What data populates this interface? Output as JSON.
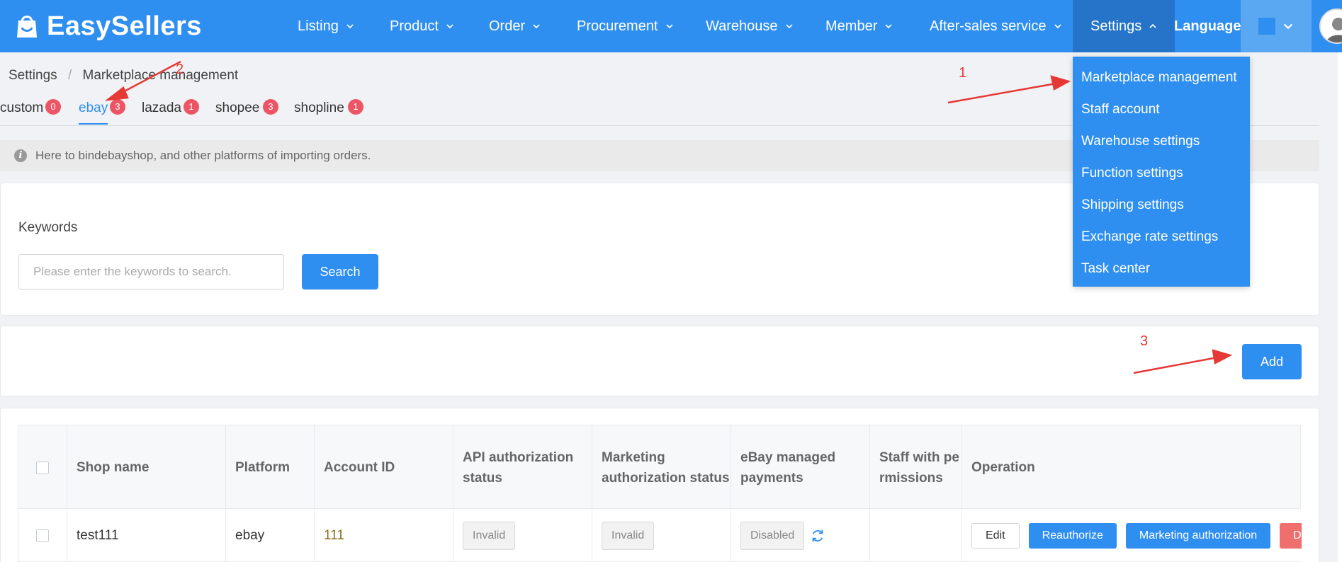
{
  "brand": {
    "name": "EasySellers"
  },
  "nav": {
    "items": [
      {
        "label": "Listing"
      },
      {
        "label": "Product"
      },
      {
        "label": "Order"
      },
      {
        "label": "Procurement"
      },
      {
        "label": "Warehouse"
      },
      {
        "label": "Member"
      },
      {
        "label": "After-sales service"
      },
      {
        "label": "Settings"
      }
    ],
    "language": "Language"
  },
  "breadcrumb": {
    "root": "Settings",
    "separator": "/",
    "current": "Marketplace management"
  },
  "tabs": [
    {
      "label": "custom",
      "count": "0"
    },
    {
      "label": "ebay",
      "count": "3"
    },
    {
      "label": "lazada",
      "count": "1"
    },
    {
      "label": "shopee",
      "count": "3"
    },
    {
      "label": "shopline",
      "count": "1"
    }
  ],
  "info": {
    "text": "Here to bindebayshop, and other platforms of importing orders."
  },
  "search": {
    "label": "Keywords",
    "placeholder": "Please enter the keywords to search.",
    "button": "Search"
  },
  "actions": {
    "add": "Add"
  },
  "table": {
    "headers": {
      "shop_name": "Shop name",
      "platform": "Platform",
      "account_id": "Account ID",
      "api_status": "API authorization status",
      "marketing_status": "Marketing authorization status",
      "managed_payments": "eBay managed payments",
      "staff": "Staff with permissions",
      "operation": "Operation"
    },
    "rows": [
      {
        "shop_name": "test111",
        "platform": "ebay",
        "account_id": "111",
        "api_status": "Invalid",
        "marketing_status": "Invalid",
        "managed_payments": "Disabled",
        "staff": "",
        "ops": {
          "edit": "Edit",
          "reauthorize": "Reauthorize",
          "marketing": "Marketing authorization",
          "delete": "Del"
        }
      }
    ]
  },
  "settings_menu": [
    {
      "label": "Marketplace management"
    },
    {
      "label": "Staff account"
    },
    {
      "label": "Warehouse settings"
    },
    {
      "label": "Function settings"
    },
    {
      "label": "Shipping settings"
    },
    {
      "label": "Exchange rate settings"
    },
    {
      "label": "Task center"
    }
  ],
  "annotations": {
    "step1": "1",
    "step2": "2",
    "step3": "3"
  },
  "colors": {
    "primary": "#2f8ff0",
    "nav_active": "#2574c9",
    "badge": "#ed5565",
    "annotation": "#e53935"
  }
}
